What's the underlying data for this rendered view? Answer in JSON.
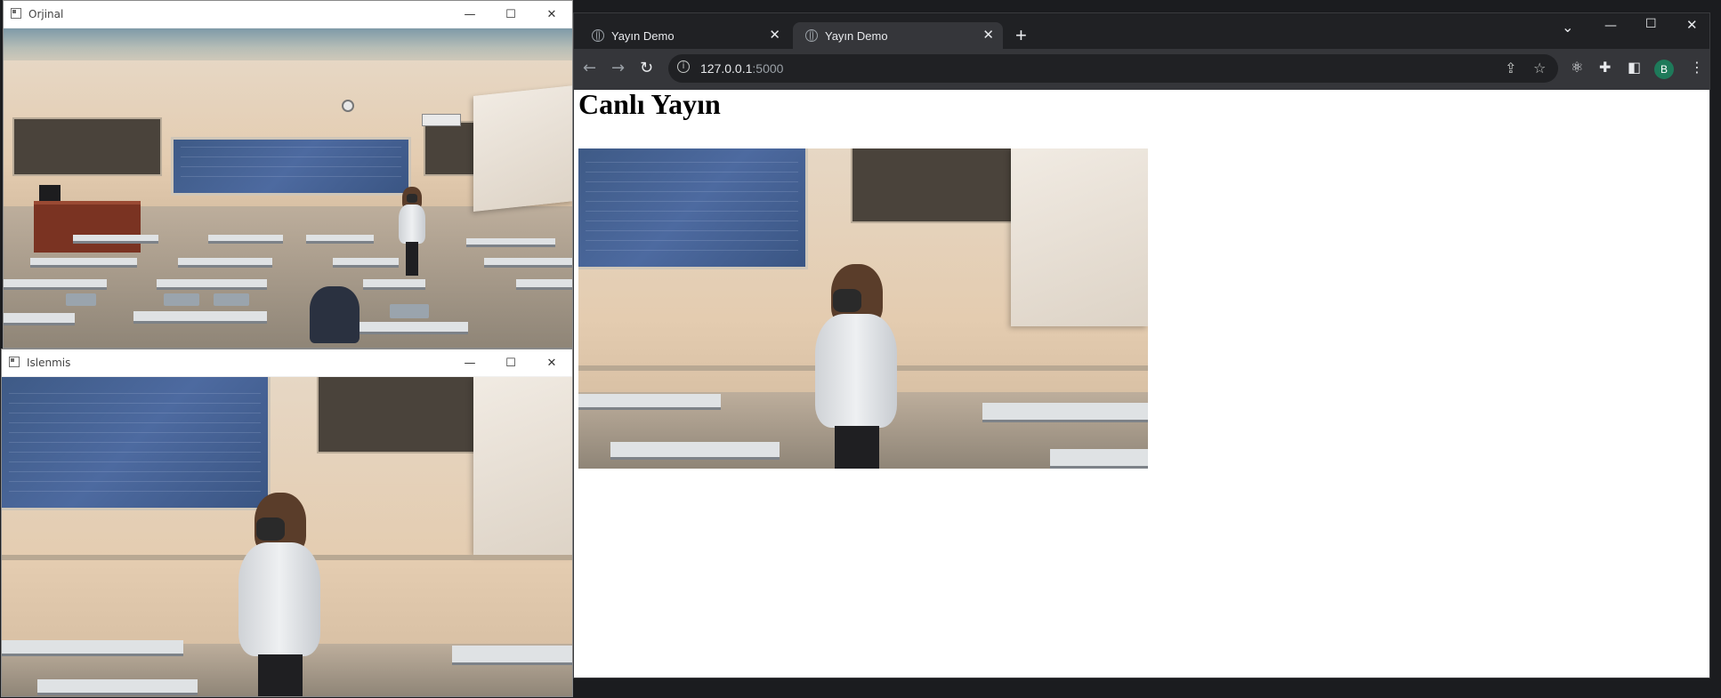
{
  "windows": {
    "original": {
      "title": "Orjinal",
      "controls": [
        "—",
        "☐",
        "✕"
      ]
    },
    "processed": {
      "title": "Islenmis",
      "controls": [
        "—",
        "☐",
        "✕"
      ]
    }
  },
  "browser": {
    "tabs": [
      {
        "label": "Yayın Demo",
        "close": "✕",
        "active": false
      },
      {
        "label": "Yayın Demo",
        "close": "✕",
        "active": true
      }
    ],
    "new_tab": "+",
    "window_controls": {
      "list_tabs": "⌄",
      "minimize": "—",
      "maximize": "☐",
      "close": "✕"
    },
    "nav": {
      "back": "←",
      "forward": "→",
      "reload": "↻"
    },
    "url": {
      "host": "127.0.0.1",
      "port": ":5000"
    },
    "profile_initial": "B",
    "page": {
      "heading": "Canlı Yayın"
    }
  },
  "colors": {
    "tabstrip": "#202124",
    "toolbar": "#35363a",
    "profile": "#1e7a5a"
  }
}
